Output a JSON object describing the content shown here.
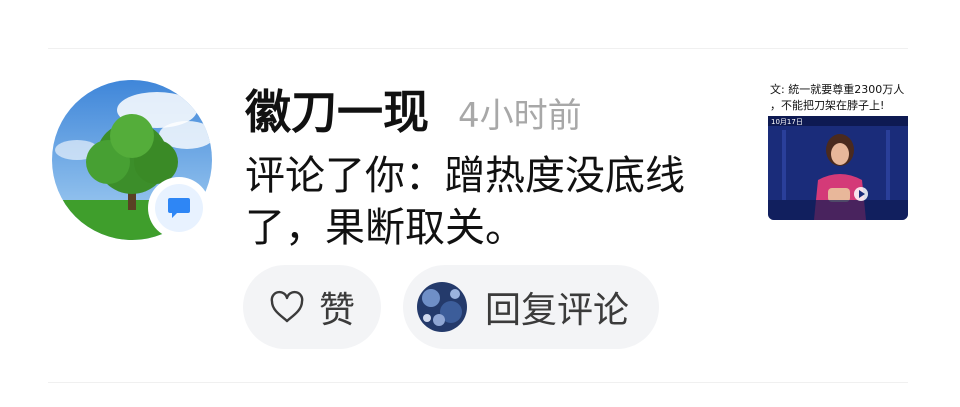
{
  "notification": {
    "username": "徽刀一现",
    "time": "4小时前",
    "comment": "评论了你：蹭热度没底线了，果断取关。",
    "avatar": "tree-avatar",
    "badge_icon": "comment-bubble-icon",
    "colors": {
      "accent": "#2e86f5",
      "pill_bg": "#f3f4f6",
      "muted_text": "#a8a8a8"
    }
  },
  "actions": {
    "like_icon": "heart-outline-icon",
    "like_label": "赞",
    "reply_label": "回复评论",
    "reply_avatar": "user-avatar"
  },
  "thumbnail": {
    "caption_line1": "文: 統一就要尊重2300万人",
    "caption_line2": "，不能把刀架在脖子上!",
    "date_overlay": "10月17日"
  }
}
